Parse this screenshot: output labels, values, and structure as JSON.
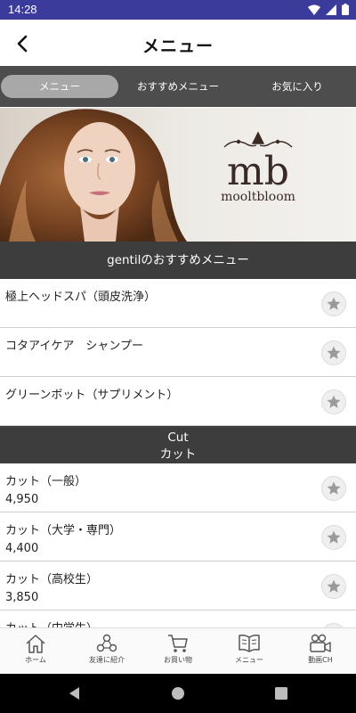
{
  "status_bar": {
    "time": "14:28",
    "icons": [
      "wifi-icon",
      "signal-icon",
      "battery-icon"
    ]
  },
  "header": {
    "title": "メニュー",
    "back_icon": "chevron-left-icon"
  },
  "tabs": [
    {
      "label": "メニュー",
      "active": true
    },
    {
      "label": "おすすめメニュー",
      "active": false
    },
    {
      "label": "お気に入り",
      "active": false
    }
  ],
  "banner": {
    "logo_mark": "mb",
    "logo_text": "mooltbloom"
  },
  "sections": [
    {
      "header_line1": "gentilのおすすめメニュー",
      "items": [
        {
          "title": "極上ヘッドスパ（頭皮洗浄）"
        },
        {
          "title": "コタアイケア　シャンプー"
        },
        {
          "title": "グリーンボット（サプリメント）"
        }
      ]
    },
    {
      "header_line1": "Cut",
      "header_line2": "カット",
      "items": [
        {
          "title": "カット（一般）",
          "price": "4,950"
        },
        {
          "title": "カット（大学・専門）",
          "price": "4,400"
        },
        {
          "title": "カット（高校生）",
          "price": "3,850"
        },
        {
          "title": "カット（中学生）",
          "price": ""
        }
      ]
    }
  ],
  "bottom_nav": [
    {
      "label": "ホーム",
      "icon": "home-icon"
    },
    {
      "label": "友達に紹介",
      "icon": "share-friends-icon"
    },
    {
      "label": "お買い物",
      "icon": "cart-icon"
    },
    {
      "label": "メニュー",
      "icon": "book-icon"
    },
    {
      "label": "動画CH",
      "icon": "video-camera-icon"
    }
  ],
  "colors": {
    "status_bar": "#3b3b9c",
    "section_header": "#3d3d3d",
    "tab_bar": "#4d4d4d",
    "tab_active": "#a8a8a8"
  }
}
